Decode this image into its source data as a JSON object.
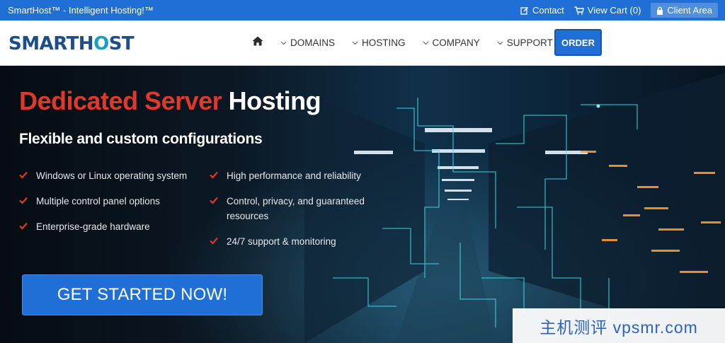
{
  "topbar": {
    "tagline": "SmartHost™ - Intelligent Hosting!™",
    "contact": "Contact",
    "cart": "View Cart (0)",
    "client_area": "Client Area"
  },
  "logo": {
    "part1": "SMARTH",
    "part2": "O",
    "part3": "ST"
  },
  "nav": {
    "home_icon": "home-icon",
    "items": [
      "DOMAINS",
      "HOSTING",
      "COMPANY",
      "SUPPORT"
    ],
    "order": "ORDER"
  },
  "hero": {
    "title_red": "Dedicated Server",
    "title_white": "Hosting",
    "subtitle": "Flexible and custom configurations",
    "features_left": [
      "Windows or Linux operating system",
      "Multiple control panel options",
      "Enterprise-grade hardware"
    ],
    "features_right": [
      "High performance and reliability",
      "Control, privacy, and guaranteed resources",
      "24/7 support & monitoring"
    ],
    "cta": "GET STARTED NOW!"
  },
  "watermark": "主机测评 vpsmr.com",
  "colors": {
    "primary_blue": "#1f6fd6",
    "accent_red": "#e0392b",
    "logo_blue": "#1b4e8a",
    "logo_teal": "#1a9ec0"
  }
}
